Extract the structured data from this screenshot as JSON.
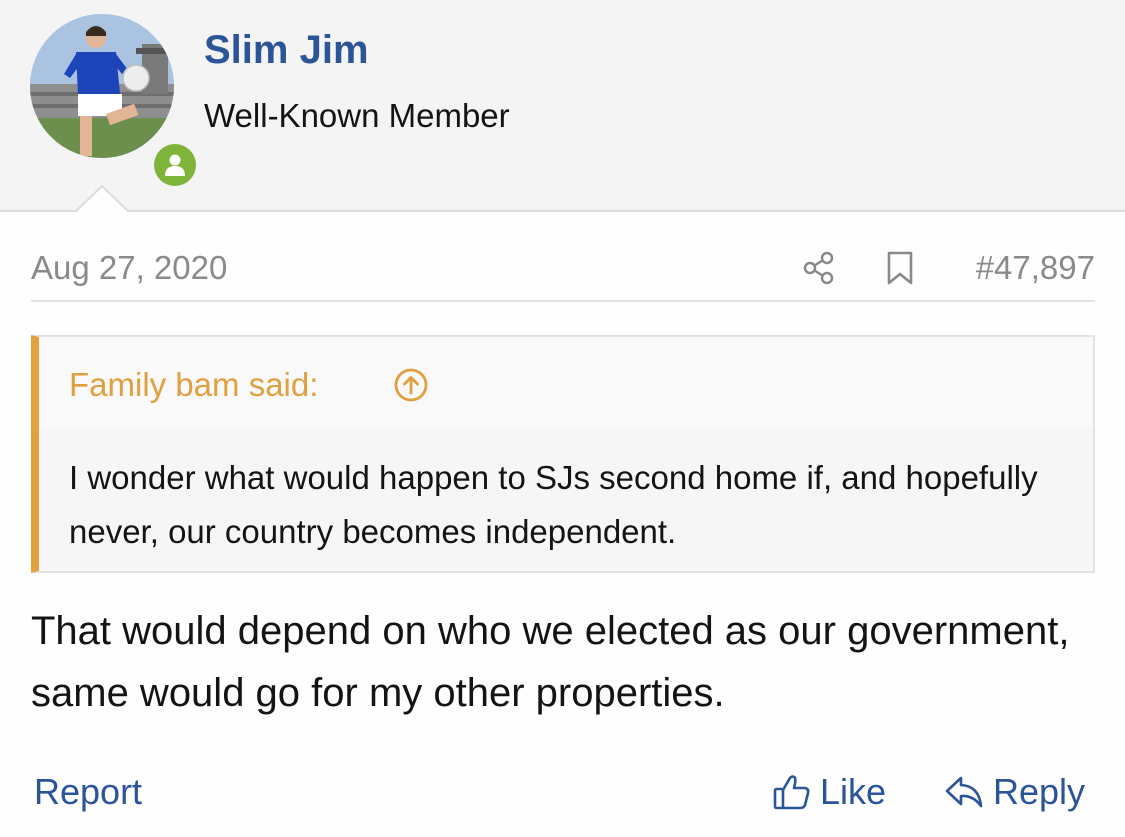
{
  "user": {
    "name": "Slim Jim",
    "title": "Well-Known Member",
    "avatar_icon": "user-avatar-photo",
    "status_icon": "online-user-icon",
    "accent_color": "#2b5597",
    "online_color": "#7fb43a"
  },
  "post": {
    "date": "Aug 27, 2020",
    "number": "#47,897",
    "share_icon": "share-icon",
    "bookmark_icon": "bookmark-icon"
  },
  "quote": {
    "author_label": "Family bam said:",
    "expand_icon": "arrow-up-circle-icon",
    "text": "I wonder what would happen to SJs second home if, and hopefully never, our country becomes independent.",
    "accent_color": "#e4a23e"
  },
  "message": {
    "text": "That would depend on who we elected as our government, same would go for my other properties."
  },
  "actions": {
    "report": "Report",
    "like": "Like",
    "reply": "Reply",
    "like_icon": "thumbs-up-icon",
    "reply_icon": "reply-arrow-icon"
  }
}
